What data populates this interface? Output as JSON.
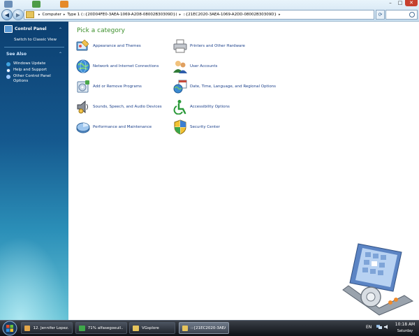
{
  "address_bar": {
    "crumbs": [
      "Computer",
      "Type 1 (::{20D04FE0-3AEA-1069-A2D8-08002B30309D})",
      "::{21EC2020-3AEA-1069-A2DD-08002B30309D}"
    ]
  },
  "window_controls": {
    "minimize": "–",
    "maximize": "□",
    "close": "✕"
  },
  "sidebar": {
    "title": "Control Panel",
    "switch_view": "Switch to Classic View",
    "see_also": "See Also",
    "items": [
      {
        "label": "Windows Update",
        "icon": "windows-update-icon",
        "color": "#3ea3e0"
      },
      {
        "label": "Help and Support",
        "icon": "help-icon",
        "color": "#ffffff"
      },
      {
        "label": "Other Control Panel Options",
        "icon": "control-panel-options-icon",
        "color": "#9ec9ff"
      }
    ]
  },
  "main": {
    "heading": "Pick a category",
    "categories": [
      {
        "label": "Appearance and Themes",
        "icon": "appearance-themes-icon"
      },
      {
        "label": "Printers and Other Hardware",
        "icon": "printer-icon"
      },
      {
        "label": "Network and Internet Connections",
        "icon": "network-globe-icon"
      },
      {
        "label": "User Accounts",
        "icon": "user-accounts-icon"
      },
      {
        "label": "Add or Remove Programs",
        "icon": "add-remove-programs-icon"
      },
      {
        "label": "Date, Time, Language, and Regional Options",
        "icon": "date-time-globe-icon"
      },
      {
        "label": "Sounds, Speech, and Audio Devices",
        "icon": "speaker-icon"
      },
      {
        "label": "Accessibility Options",
        "icon": "accessibility-icon"
      },
      {
        "label": "Performance and Maintenance",
        "icon": "performance-pie-icon"
      },
      {
        "label": "Security Center",
        "icon": "security-shield-icon"
      }
    ]
  },
  "taskbar": {
    "tasks": [
      {
        "label": "12. Jennifer Lopez...",
        "icon": "media-player-icon",
        "active": false
      },
      {
        "label": "71% alfasegoeuil...",
        "icon": "download-progress-icon",
        "active": false
      },
      {
        "label": "VGsplore",
        "icon": "folder-icon",
        "active": false
      },
      {
        "label": "::{21EC2020-3AEA...",
        "icon": "control-panel-folder-icon",
        "active": true
      }
    ],
    "language": "EN",
    "time": "10:18 AM",
    "day": "Saturday"
  },
  "colors": {
    "heading_green": "#3b8f2a",
    "link_blue": "#1a3f8a",
    "sidebar_top": "#0c3f70",
    "sidebar_bottom": "#67c3d6"
  }
}
